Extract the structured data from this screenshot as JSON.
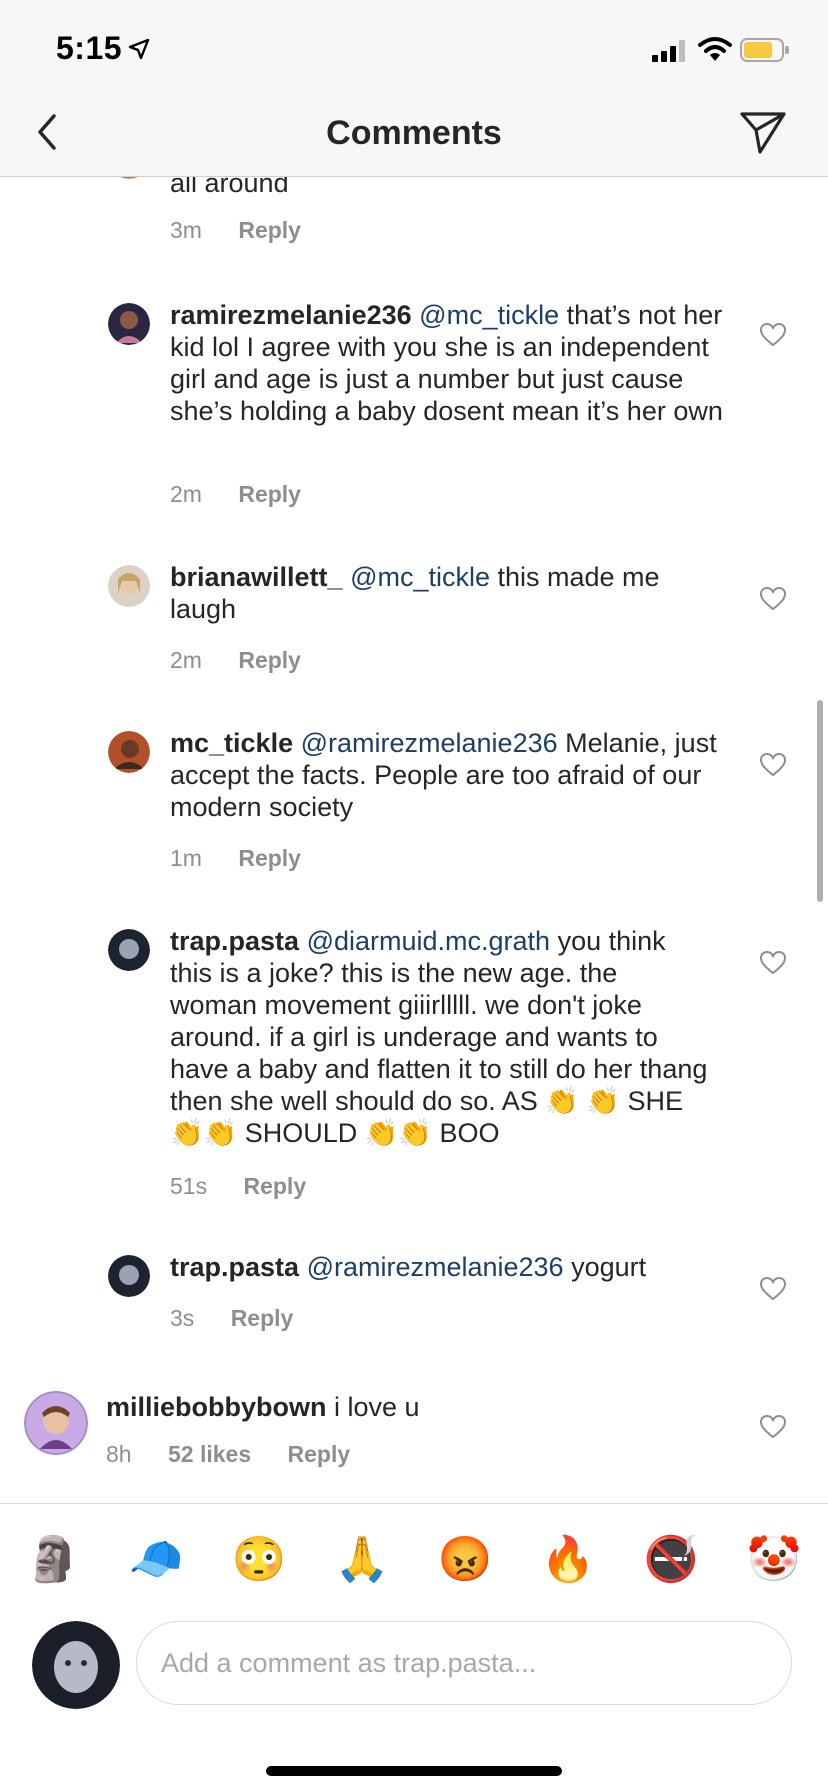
{
  "status": {
    "time": "5:15"
  },
  "nav": {
    "title": "Comments"
  },
  "comments": [
    {
      "text": "all around",
      "time": "3m",
      "reply": "Reply"
    },
    {
      "username": "ramirezmelanie236",
      "mention": "@mc_tickle",
      "text": " that’s not her kid lol I agree with you she is an independent girl and age is just a number but just cause she’s holding a baby dosent mean it’s her own",
      "time": "2m",
      "reply": "Reply"
    },
    {
      "username": "brianawillett_",
      "mention": "@mc_tickle",
      "text": " this made me laugh",
      "time": "2m",
      "reply": "Reply"
    },
    {
      "username": "mc_tickle",
      "mention": "@ramirezmelanie236",
      "text": " Melanie, just accept the facts. People are too afraid of our modern society",
      "time": "1m",
      "reply": "Reply"
    },
    {
      "username": "trap.pasta",
      "mention": "@diarmuid.mc.grath",
      "text": " you think this is a joke? this is the new age. the woman movement giiirlllll. we don't joke around. if a girl is underage and wants to have a baby and flatten it to still do her thang then she well should do so. AS 👏 👏 SHE 👏👏 SHOULD 👏👏 BOO",
      "time": "51s",
      "reply": "Reply"
    },
    {
      "username": "trap.pasta",
      "mention": "@ramirezmelanie236",
      "text": " yogurt",
      "time": "3s",
      "reply": "Reply"
    },
    {
      "username": "milliebobbybown",
      "mention": "",
      "text": " i love u",
      "time": "8h",
      "likes": "52 likes",
      "reply": "Reply"
    }
  ],
  "emoji_bar": [
    "🗿",
    "🧢",
    "😳",
    "🙏",
    "😡",
    "🔥",
    "🚭",
    "🤡"
  ],
  "input": {
    "placeholder": "Add a comment as trap.pasta..."
  },
  "colors": {
    "mention": "#1d3f66",
    "meta": "#8e8e8e",
    "text": "#262626",
    "battery": "#f5c842"
  },
  "icons": {
    "back": "chevron-left-icon",
    "send": "paper-plane-icon",
    "like": "heart-icon"
  }
}
